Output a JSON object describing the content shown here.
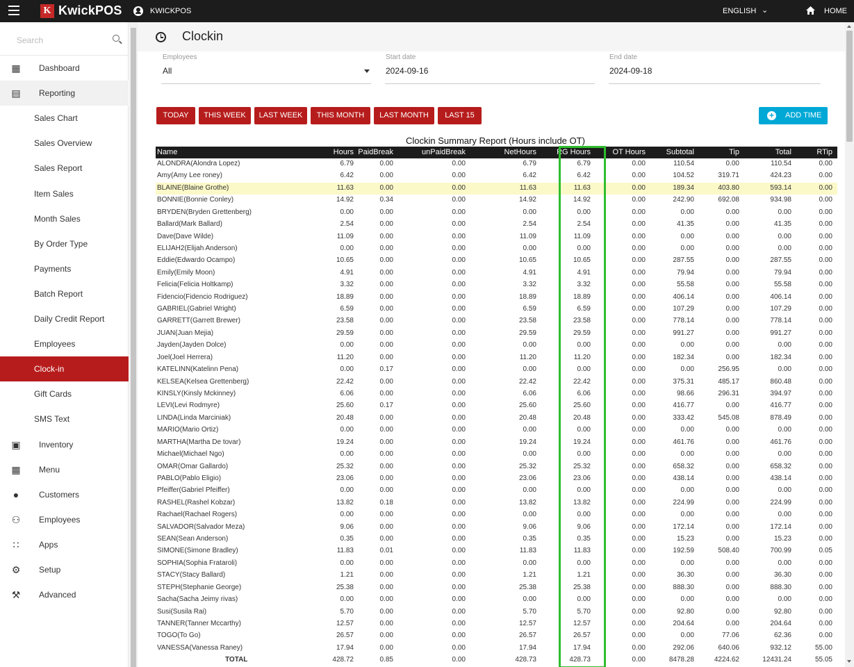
{
  "topbar": {
    "brand": "KwickPOS",
    "logo_letter": "K",
    "account": "KWICKPOS",
    "language": "ENGLISH",
    "home": "HOME"
  },
  "sidebar": {
    "search_placeholder": "Search",
    "items": [
      {
        "label": "Dashboard",
        "icon": "dashboard-icon"
      },
      {
        "label": "Reporting",
        "icon": "reporting-icon"
      },
      {
        "label": "Sales Chart"
      },
      {
        "label": "Sales Overview"
      },
      {
        "label": "Sales Report"
      },
      {
        "label": "Item Sales"
      },
      {
        "label": "Month Sales"
      },
      {
        "label": "By Order Type"
      },
      {
        "label": "Payments"
      },
      {
        "label": "Batch Report"
      },
      {
        "label": "Daily Credit Report"
      },
      {
        "label": "Employees"
      },
      {
        "label": "Clock-in"
      },
      {
        "label": "Gift Cards"
      },
      {
        "label": "SMS Text"
      },
      {
        "label": "Inventory",
        "icon": "clipboard-icon"
      },
      {
        "label": "Menu",
        "icon": "grid-icon"
      },
      {
        "label": "Customers",
        "icon": "account-circle-icon"
      },
      {
        "label": "Employees",
        "icon": "people-icon"
      },
      {
        "label": "Apps",
        "icon": "apps-icon"
      },
      {
        "label": "Setup",
        "icon": "gear-icon"
      },
      {
        "label": "Advanced",
        "icon": "wrench-icon"
      }
    ]
  },
  "page": {
    "title": "Clockin",
    "filters": {
      "employees_label": "Employees",
      "employees_value": "All",
      "start_label": "Start date",
      "start_value": "2024-09-16",
      "end_label": "End date",
      "end_value": "2024-09-18"
    },
    "buttons": {
      "today": "TODAY",
      "this_week": "THIS WEEK",
      "last_week": "LAST WEEK",
      "this_month": "THIS MONTH",
      "last_month": "LAST MONTH",
      "last_15": "LAST 15",
      "add_time": "ADD TIME"
    },
    "report_title": "Clockin Summary Report (Hours include OT)"
  },
  "table": {
    "columns": [
      "Name",
      "Hours",
      "PaidBreak",
      "unPaidBreak",
      "NetHours",
      "RG Hours",
      "OT Hours",
      "Subtotal",
      "Tip",
      "Total",
      "RTip"
    ],
    "rows": [
      [
        "ALONDRA(Alondra Lopez)",
        "6.79",
        "0.00",
        "0.00",
        "6.79",
        "6.79",
        "0.00",
        "110.54",
        "0.00",
        "110.54",
        "0.00"
      ],
      [
        "Amy(Amy Lee roney)",
        "6.42",
        "0.00",
        "0.00",
        "6.42",
        "6.42",
        "0.00",
        "104.52",
        "319.71",
        "424.23",
        "0.00"
      ],
      [
        "BLAINE(Blaine Grothe)",
        "11.63",
        "0.00",
        "0.00",
        "11.63",
        "11.63",
        "0.00",
        "189.34",
        "403.80",
        "593.14",
        "0.00"
      ],
      [
        "BONNIE(Bonnie Conley)",
        "14.92",
        "0.34",
        "0.00",
        "14.92",
        "14.92",
        "0.00",
        "242.90",
        "692.08",
        "934.98",
        "0.00"
      ],
      [
        "BRYDEN(Bryden Grettenberg)",
        "0.00",
        "0.00",
        "0.00",
        "0.00",
        "0.00",
        "0.00",
        "0.00",
        "0.00",
        "0.00",
        "0.00"
      ],
      [
        "Ballard(Mark Ballard)",
        "2.54",
        "0.00",
        "0.00",
        "2.54",
        "2.54",
        "0.00",
        "41.35",
        "0.00",
        "41.35",
        "0.00"
      ],
      [
        "Dave(Dave Wilde)",
        "11.09",
        "0.00",
        "0.00",
        "11.09",
        "11.09",
        "0.00",
        "0.00",
        "0.00",
        "0.00",
        "0.00"
      ],
      [
        "ELIJAH2(Elijah Anderson)",
        "0.00",
        "0.00",
        "0.00",
        "0.00",
        "0.00",
        "0.00",
        "0.00",
        "0.00",
        "0.00",
        "0.00"
      ],
      [
        "Eddie(Edwardo Ocampo)",
        "10.65",
        "0.00",
        "0.00",
        "10.65",
        "10.65",
        "0.00",
        "287.55",
        "0.00",
        "287.55",
        "0.00"
      ],
      [
        "Emily(Emily Moon)",
        "4.91",
        "0.00",
        "0.00",
        "4.91",
        "4.91",
        "0.00",
        "79.94",
        "0.00",
        "79.94",
        "0.00"
      ],
      [
        "Felicia(Felicia Holtkamp)",
        "3.32",
        "0.00",
        "0.00",
        "3.32",
        "3.32",
        "0.00",
        "55.58",
        "0.00",
        "55.58",
        "0.00"
      ],
      [
        "Fidencio(Fidencio Rodriguez)",
        "18.89",
        "0.00",
        "0.00",
        "18.89",
        "18.89",
        "0.00",
        "406.14",
        "0.00",
        "406.14",
        "0.00"
      ],
      [
        "GABRIEL(Gabriel Wright)",
        "6.59",
        "0.00",
        "0.00",
        "6.59",
        "6.59",
        "0.00",
        "107.29",
        "0.00",
        "107.29",
        "0.00"
      ],
      [
        "GARRETT(Garrett Brewer)",
        "23.58",
        "0.00",
        "0.00",
        "23.58",
        "23.58",
        "0.00",
        "778.14",
        "0.00",
        "778.14",
        "0.00"
      ],
      [
        "JUAN(Juan Mejia)",
        "29.59",
        "0.00",
        "0.00",
        "29.59",
        "29.59",
        "0.00",
        "991.27",
        "0.00",
        "991.27",
        "0.00"
      ],
      [
        "Jayden(Jayden Dolce)",
        "0.00",
        "0.00",
        "0.00",
        "0.00",
        "0.00",
        "0.00",
        "0.00",
        "0.00",
        "0.00",
        "0.00"
      ],
      [
        "Joel(Joel Herrera)",
        "11.20",
        "0.00",
        "0.00",
        "11.20",
        "11.20",
        "0.00",
        "182.34",
        "0.00",
        "182.34",
        "0.00"
      ],
      [
        "KATELINN(Katelinn Pena)",
        "0.00",
        "0.17",
        "0.00",
        "0.00",
        "0.00",
        "0.00",
        "0.00",
        "256.95",
        "0.00",
        "0.00"
      ],
      [
        "KELSEA(Kelsea Grettenberg)",
        "22.42",
        "0.00",
        "0.00",
        "22.42",
        "22.42",
        "0.00",
        "375.31",
        "485.17",
        "860.48",
        "0.00"
      ],
      [
        "KINSLY(Kinsly Mckinney)",
        "6.06",
        "0.00",
        "0.00",
        "6.06",
        "6.06",
        "0.00",
        "98.66",
        "296.31",
        "394.97",
        "0.00"
      ],
      [
        "LEVI(Levi Rodmyre)",
        "25.60",
        "0.17",
        "0.00",
        "25.60",
        "25.60",
        "0.00",
        "416.77",
        "0.00",
        "416.77",
        "0.00"
      ],
      [
        "LINDA(Linda Marciniak)",
        "20.48",
        "0.00",
        "0.00",
        "20.48",
        "20.48",
        "0.00",
        "333.42",
        "545.08",
        "878.49",
        "0.00"
      ],
      [
        "MARIO(Mario Ortiz)",
        "0.00",
        "0.00",
        "0.00",
        "0.00",
        "0.00",
        "0.00",
        "0.00",
        "0.00",
        "0.00",
        "0.00"
      ],
      [
        "MARTHA(Martha De tovar)",
        "19.24",
        "0.00",
        "0.00",
        "19.24",
        "19.24",
        "0.00",
        "461.76",
        "0.00",
        "461.76",
        "0.00"
      ],
      [
        "Michael(Michael Ngo)",
        "0.00",
        "0.00",
        "0.00",
        "0.00",
        "0.00",
        "0.00",
        "0.00",
        "0.00",
        "0.00",
        "0.00"
      ],
      [
        "OMAR(Omar Gallardo)",
        "25.32",
        "0.00",
        "0.00",
        "25.32",
        "25.32",
        "0.00",
        "658.32",
        "0.00",
        "658.32",
        "0.00"
      ],
      [
        "PABLO(Pablo Eligio)",
        "23.06",
        "0.00",
        "0.00",
        "23.06",
        "23.06",
        "0.00",
        "438.14",
        "0.00",
        "438.14",
        "0.00"
      ],
      [
        "Pfeiffer(Gabriel Pfeiffer)",
        "0.00",
        "0.00",
        "0.00",
        "0.00",
        "0.00",
        "0.00",
        "0.00",
        "0.00",
        "0.00",
        "0.00"
      ],
      [
        "RASHEL(Rashel Kobzar)",
        "13.82",
        "0.18",
        "0.00",
        "13.82",
        "13.82",
        "0.00",
        "224.99",
        "0.00",
        "224.99",
        "0.00"
      ],
      [
        "Rachael(Rachael Rogers)",
        "0.00",
        "0.00",
        "0.00",
        "0.00",
        "0.00",
        "0.00",
        "0.00",
        "0.00",
        "0.00",
        "0.00"
      ],
      [
        "SALVADOR(Salvador Meza)",
        "9.06",
        "0.00",
        "0.00",
        "9.06",
        "9.06",
        "0.00",
        "172.14",
        "0.00",
        "172.14",
        "0.00"
      ],
      [
        "SEAN(Sean Anderson)",
        "0.35",
        "0.00",
        "0.00",
        "0.35",
        "0.35",
        "0.00",
        "15.23",
        "0.00",
        "15.23",
        "0.00"
      ],
      [
        "SIMONE(Simone Bradley)",
        "11.83",
        "0.01",
        "0.00",
        "11.83",
        "11.83",
        "0.00",
        "192.59",
        "508.40",
        "700.99",
        "0.05"
      ],
      [
        "SOPHIA(Sophia Frataroli)",
        "0.00",
        "0.00",
        "0.00",
        "0.00",
        "0.00",
        "0.00",
        "0.00",
        "0.00",
        "0.00",
        "0.00"
      ],
      [
        "STACY(Stacy Ballard)",
        "1.21",
        "0.00",
        "0.00",
        "1.21",
        "1.21",
        "0.00",
        "36.30",
        "0.00",
        "36.30",
        "0.00"
      ],
      [
        "STEPH(Stephanie George)",
        "25.38",
        "0.00",
        "0.00",
        "25.38",
        "25.38",
        "0.00",
        "888.30",
        "0.00",
        "888.30",
        "0.00"
      ],
      [
        "Sacha(Sacha Jeimy rivas)",
        "0.00",
        "0.00",
        "0.00",
        "0.00",
        "0.00",
        "0.00",
        "0.00",
        "0.00",
        "0.00",
        "0.00"
      ],
      [
        "Susi(Susila Rai)",
        "5.70",
        "0.00",
        "0.00",
        "5.70",
        "5.70",
        "0.00",
        "92.80",
        "0.00",
        "92.80",
        "0.00"
      ],
      [
        "TANNER(Tanner Mccarthy)",
        "12.57",
        "0.00",
        "0.00",
        "12.57",
        "12.57",
        "0.00",
        "204.64",
        "0.00",
        "204.64",
        "0.00"
      ],
      [
        "TOGO(To Go)",
        "26.57",
        "0.00",
        "0.00",
        "26.57",
        "26.57",
        "0.00",
        "0.00",
        "77.06",
        "62.36",
        "0.00"
      ],
      [
        "VANESSA(Vanessa Raney)",
        "17.94",
        "0.00",
        "0.00",
        "17.94",
        "17.94",
        "0.00",
        "292.06",
        "640.06",
        "932.12",
        "55.00"
      ]
    ],
    "total": [
      "TOTAL",
      "428.72",
      "0.85",
      "0.00",
      "428.73",
      "428.73",
      "0.00",
      "8478.28",
      "4224.62",
      "12431.24",
      "55.05"
    ]
  },
  "colors": {
    "brand_red": "#b71c1c",
    "accent_cyan": "#00a8d6",
    "highlight_green": "#2ebd2e",
    "row_highlight": "#fbf9c8"
  }
}
